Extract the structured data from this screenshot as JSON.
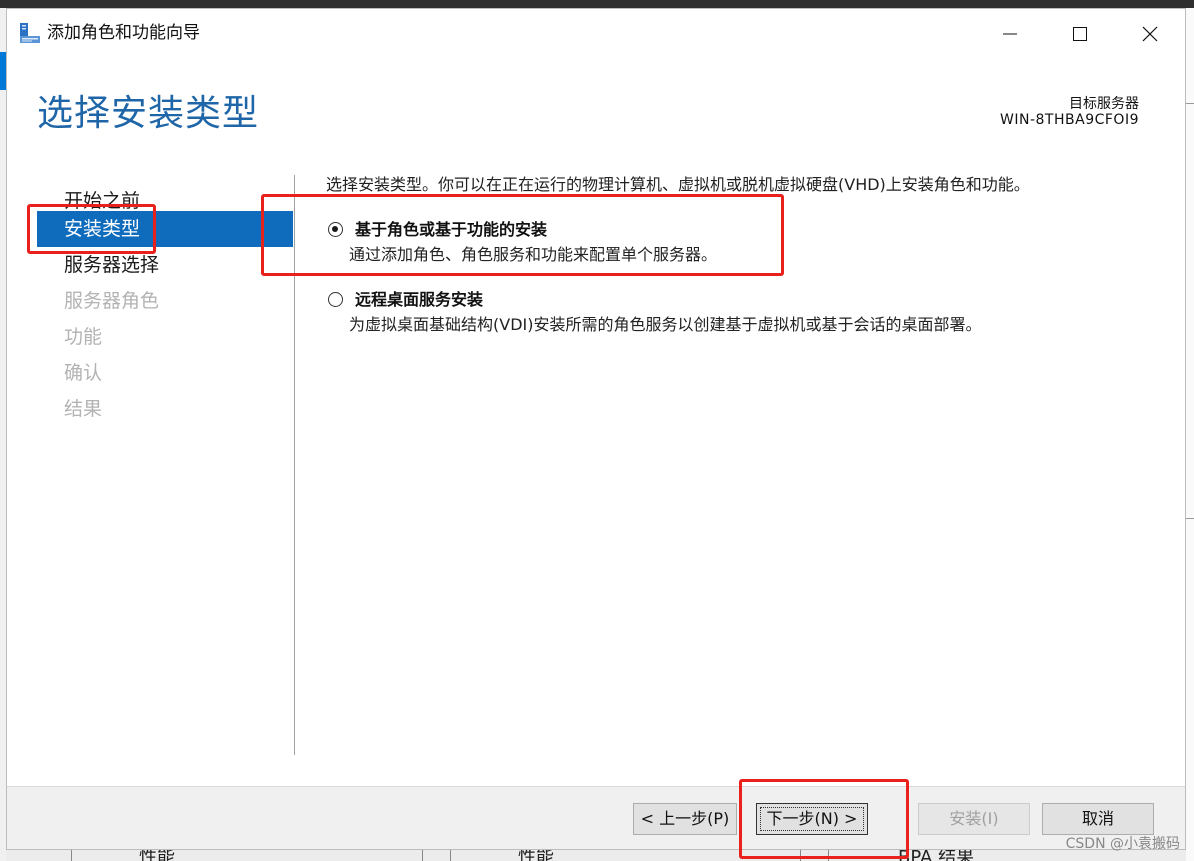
{
  "window": {
    "title": "添加角色和功能向导",
    "minimize_icon": "minimize-icon",
    "maximize_icon": "maximize-icon",
    "close_icon": "close-icon"
  },
  "header": {
    "page_title": "选择安装类型",
    "target_label": "目标服务器",
    "target_name": "WIN-8THBA9CFOI9"
  },
  "nav": {
    "items": [
      {
        "label": "开始之前",
        "state": "normal"
      },
      {
        "label": "安装类型",
        "state": "active"
      },
      {
        "label": "服务器选择",
        "state": "normal"
      },
      {
        "label": "服务器角色",
        "state": "disabled"
      },
      {
        "label": "功能",
        "state": "disabled"
      },
      {
        "label": "确认",
        "state": "disabled"
      },
      {
        "label": "结果",
        "state": "disabled"
      }
    ]
  },
  "content": {
    "description": "选择安装类型。你可以在正在运行的物理计算机、虚拟机或脱机虚拟硬盘(VHD)上安装角色和功能。",
    "options": [
      {
        "title": "基于角色或基于功能的安装",
        "desc": "通过添加角色、角色服务和功能来配置单个服务器。",
        "selected": true
      },
      {
        "title": "远程桌面服务安装",
        "desc": "为虚拟桌面基础结构(VDI)安装所需的角色服务以创建基于虚拟机或基于会话的桌面部署。",
        "selected": false
      }
    ]
  },
  "footer": {
    "back": "< 上一步(P)",
    "next": "下一步(N) >",
    "install": "安装(I)",
    "cancel": "取消"
  },
  "background": {
    "col1": "性能",
    "col2": "性能",
    "col3": "BPA 结果"
  },
  "watermark": "CSDN @小袁搬码",
  "colors": {
    "accent": "#0f6cbd",
    "title_blue": "#1f66a8",
    "highlight_red": "#e8211d"
  }
}
